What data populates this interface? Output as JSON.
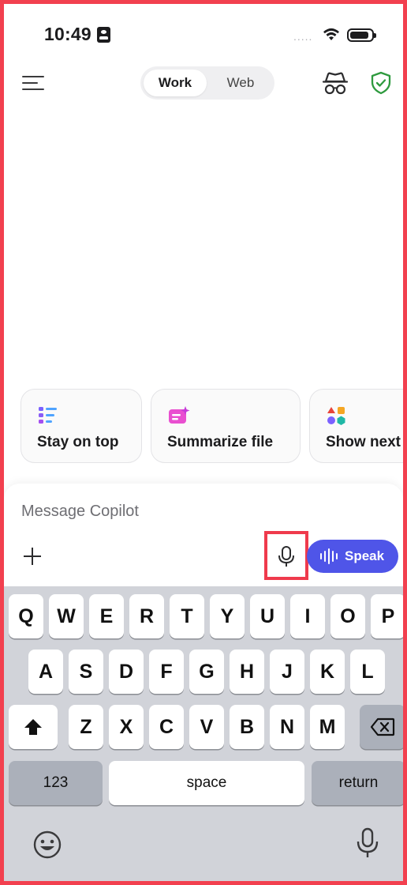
{
  "status": {
    "time": "10:49",
    "signal_dots": "....."
  },
  "header": {
    "toggle_work": "Work",
    "toggle_web": "Web"
  },
  "suggestions": [
    {
      "label": "Stay on top",
      "icon": "list-icon"
    },
    {
      "label": "Summarize file",
      "icon": "document-sparkle-icon"
    },
    {
      "label": "Show next",
      "icon": "shapes-icon"
    }
  ],
  "composer": {
    "placeholder": "Message Copilot",
    "speak_label": "Speak"
  },
  "keyboard": {
    "row1": [
      "Q",
      "W",
      "E",
      "R",
      "T",
      "Y",
      "U",
      "I",
      "O",
      "P"
    ],
    "row2": [
      "A",
      "S",
      "D",
      "F",
      "G",
      "H",
      "J",
      "K",
      "L"
    ],
    "row3": [
      "Z",
      "X",
      "C",
      "V",
      "B",
      "N",
      "M"
    ],
    "numbers_label": "123",
    "space_label": "space",
    "return_label": "return"
  },
  "colors": {
    "accent": "#4f55e8",
    "highlight": "#ef3a4c",
    "shield": "#2e9a3e"
  }
}
